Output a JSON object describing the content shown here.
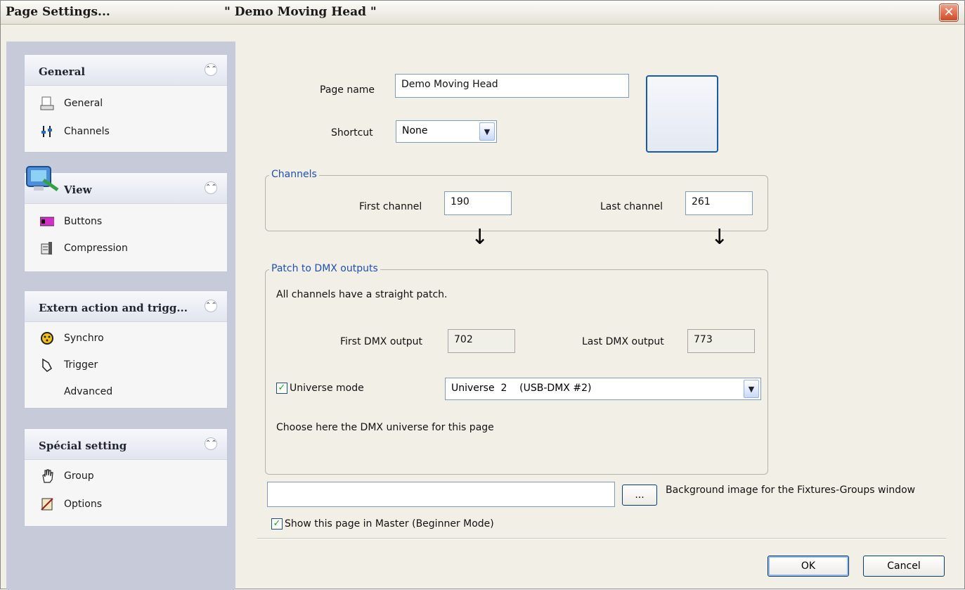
{
  "window": {
    "title": "Page  Settings...",
    "subtitle": "\" Demo Moving Head \"",
    "close_glyph": "✕"
  },
  "sidebar": {
    "panels": [
      {
        "title": "General",
        "items": [
          {
            "label": "General",
            "icon": "page-icon"
          },
          {
            "label": "Channels",
            "icon": "faders-icon"
          }
        ]
      },
      {
        "title": "View",
        "items": [
          {
            "label": "Buttons",
            "icon": "buttons-icon"
          },
          {
            "label": "Compression",
            "icon": "compression-icon"
          }
        ]
      },
      {
        "title": "Extern action and trigg...",
        "items": [
          {
            "label": "Synchro",
            "icon": "dmx-plug-icon"
          },
          {
            "label": "Trigger",
            "icon": "hand-trigger-icon"
          },
          {
            "label": "Advanced",
            "icon": ""
          }
        ]
      },
      {
        "title": "Spécial setting",
        "items": [
          {
            "label": "Group",
            "icon": "hand-icon"
          },
          {
            "label": "Options",
            "icon": "options-icon"
          }
        ]
      }
    ]
  },
  "form": {
    "page_name_label": "Page name",
    "page_name_value": "Demo Moving Head",
    "shortcut_label": "Shortcut",
    "shortcut_value": "None",
    "channels_group": "Channels",
    "first_channel_label": "First channel",
    "first_channel_value": "190",
    "last_channel_label": "Last channel",
    "last_channel_value": "261",
    "patch_group": "Patch to DMX outputs",
    "patch_note": "All channels have a straight patch.",
    "first_dmx_label": "First DMX output",
    "first_dmx_value": "702",
    "last_dmx_label": "Last DMX output",
    "last_dmx_value": "773",
    "universe_mode_label": "Universe mode",
    "universe_mode_checked": true,
    "universe_value": "Universe  2    (USB-DMX #2)",
    "universe_hint": "Choose here the DMX universe for this page",
    "bg_image_value": "",
    "browse_label": "...",
    "bg_image_label": "Background image for the Fixtures-Groups window",
    "show_master_label": "Show this page in Master (Beginner Mode)",
    "show_master_checked": true
  },
  "buttons": {
    "ok": "OK",
    "cancel": "Cancel"
  },
  "glyphs": {
    "collapse": "⌃⌃",
    "check": "✓",
    "combo_arrow": "▼",
    "down_arrow": "↓"
  },
  "colors": {
    "sidebar_bg": "#c7cad8",
    "dialog_bg": "#f1efe6",
    "group_title": "#1f4fb5",
    "close_red": "#d04a26"
  }
}
